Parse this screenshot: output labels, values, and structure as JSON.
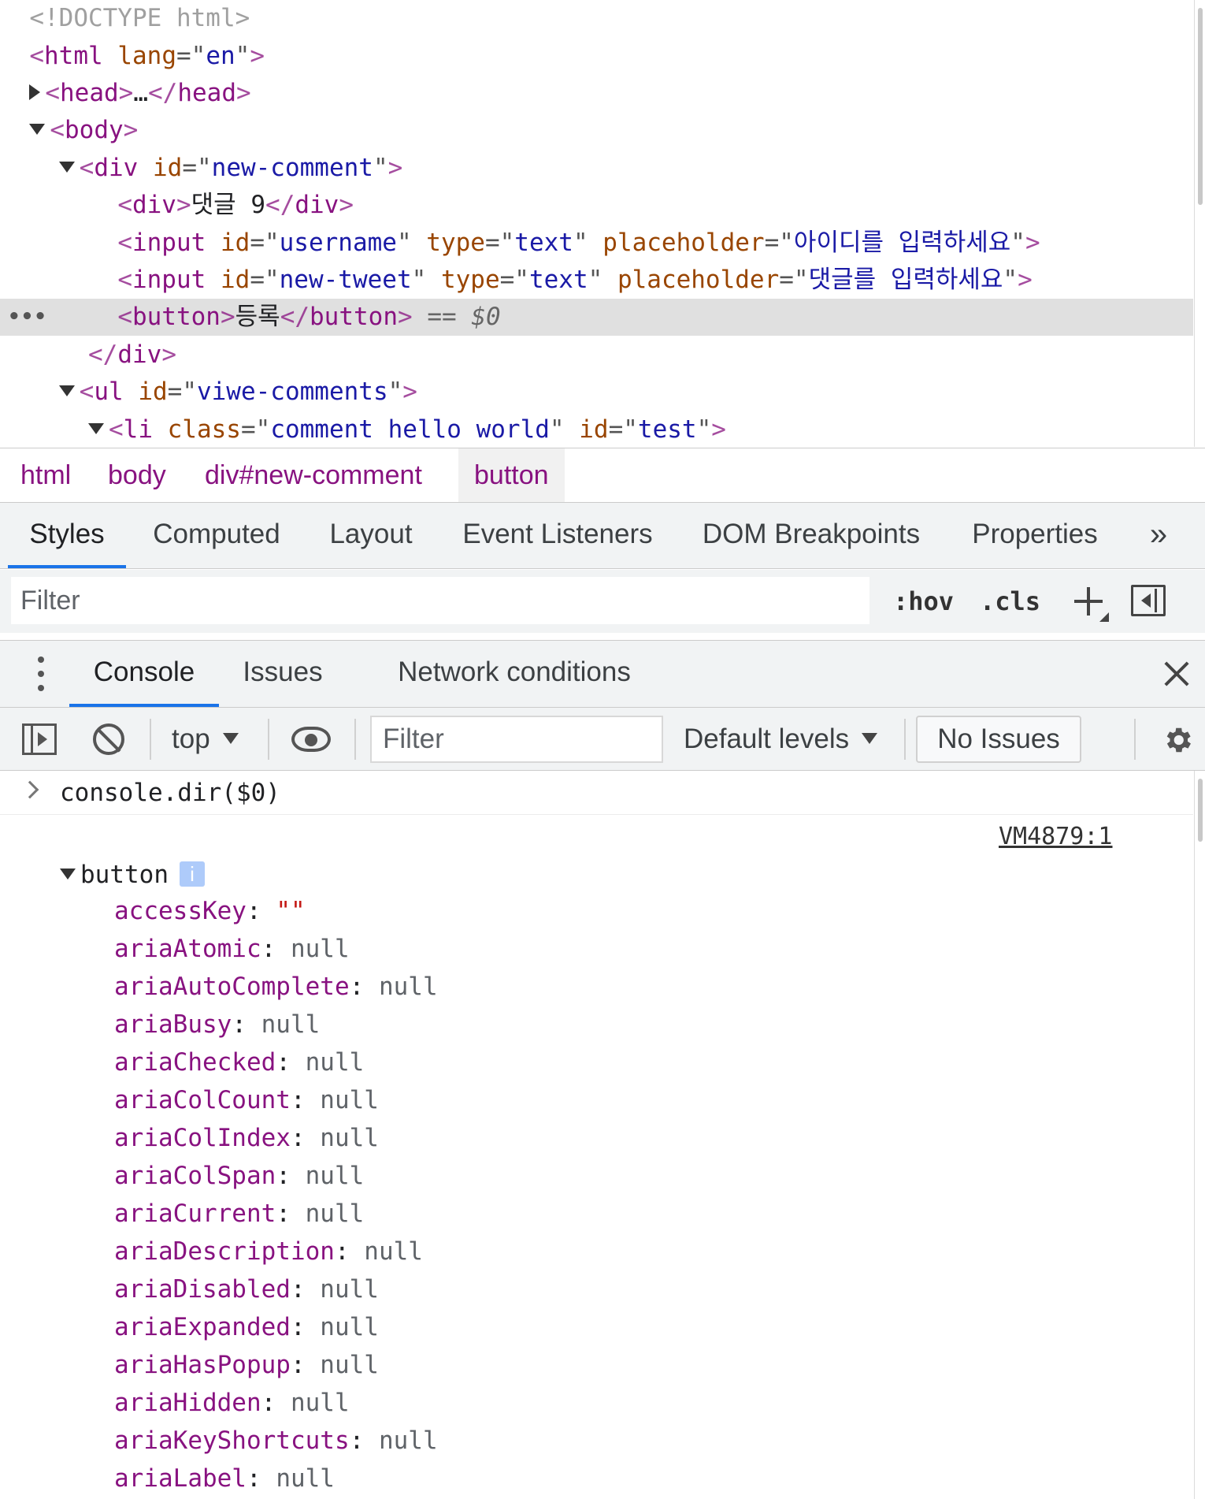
{
  "elements": {
    "lines": [
      {
        "text_doctype": "<!DOCTYPE html>"
      },
      {
        "tag": "html",
        "attr": "lang",
        "val": "en"
      },
      {
        "tag": "head",
        "collapsed": "…"
      },
      {
        "tag": "body"
      },
      {
        "tag": "div",
        "attr": "id",
        "val": "new-comment"
      },
      {
        "tag": "div",
        "text": "댓글 9"
      },
      {
        "tag": "input",
        "attrs": [
          [
            "id",
            "username"
          ],
          [
            "type",
            "text"
          ],
          [
            "placeholder",
            "아이디를 입력하세요"
          ]
        ]
      },
      {
        "tag": "input",
        "attrs": [
          [
            "id",
            "new-tweet"
          ],
          [
            "type",
            "text"
          ],
          [
            "placeholder",
            "댓글를 입력하세요"
          ]
        ]
      },
      {
        "tag": "button",
        "text": "등록",
        "hint": "== $0"
      },
      {
        "close": "div"
      },
      {
        "tag": "ul",
        "attr": "id",
        "val": "viwe-comments"
      },
      {
        "tag": "li",
        "attrs": [
          [
            "class",
            "comment hello world"
          ],
          [
            "id",
            "test"
          ]
        ]
      }
    ]
  },
  "breadcrumb": [
    "html",
    "body",
    "div#new-comment",
    "button"
  ],
  "sidebar_tabs": [
    "Styles",
    "Computed",
    "Layout",
    "Event Listeners",
    "DOM Breakpoints",
    "Properties",
    "»"
  ],
  "styles_filter": {
    "placeholder": "Filter",
    "hov": ":hov",
    "cls": ".cls"
  },
  "drawer_tabs": [
    "Console",
    "Issues",
    "Network conditions"
  ],
  "console_toolbar": {
    "context": "top",
    "filter_placeholder": "Filter",
    "levels": "Default levels",
    "issues": "No Issues"
  },
  "console": {
    "command": "console.dir($0)",
    "source": "VM4879:1",
    "object_name": "button",
    "info": "i",
    "properties": [
      {
        "key": "accessKey",
        "value": "\"\"",
        "type": "string"
      },
      {
        "key": "ariaAtomic",
        "value": "null",
        "type": "null"
      },
      {
        "key": "ariaAutoComplete",
        "value": "null",
        "type": "null"
      },
      {
        "key": "ariaBusy",
        "value": "null",
        "type": "null"
      },
      {
        "key": "ariaChecked",
        "value": "null",
        "type": "null"
      },
      {
        "key": "ariaColCount",
        "value": "null",
        "type": "null"
      },
      {
        "key": "ariaColIndex",
        "value": "null",
        "type": "null"
      },
      {
        "key": "ariaColSpan",
        "value": "null",
        "type": "null"
      },
      {
        "key": "ariaCurrent",
        "value": "null",
        "type": "null"
      },
      {
        "key": "ariaDescription",
        "value": "null",
        "type": "null"
      },
      {
        "key": "ariaDisabled",
        "value": "null",
        "type": "null"
      },
      {
        "key": "ariaExpanded",
        "value": "null",
        "type": "null"
      },
      {
        "key": "ariaHasPopup",
        "value": "null",
        "type": "null"
      },
      {
        "key": "ariaHidden",
        "value": "null",
        "type": "null"
      },
      {
        "key": "ariaKeyShortcuts",
        "value": "null",
        "type": "null"
      },
      {
        "key": "ariaLabel",
        "value": "null",
        "type": "null"
      }
    ]
  },
  "colors": {
    "tag": "#881280",
    "attr": "#994500",
    "value": "#1a1aa6",
    "accent": "#1a73e8",
    "string": "#c41a16"
  }
}
